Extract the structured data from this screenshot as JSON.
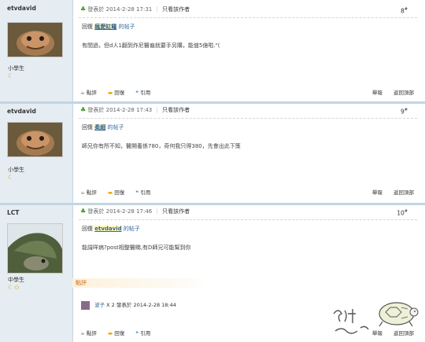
{
  "labels": {
    "posted_prefix": "發表於",
    "only_author": "只看該作者",
    "reply_prefix": "回復",
    "reply_suffix": "的帖子",
    "rate": "點評",
    "reply": "回復",
    "quote": "引用",
    "report": "舉報",
    "back_top": "返回頂部"
  },
  "posts": [
    {
      "username": "etvdavid",
      "rank": "小學生",
      "medals": "☾",
      "datetime": "2014-2-28 17:31",
      "floor": "8",
      "reply_to": "瘋愛缸黿",
      "content": "有間過，但d人1翻到炸尼醫龜就要手另購，能值5億啦.\"("
    },
    {
      "username": "etvdavid",
      "rank": "小學生",
      "medals": "☾",
      "datetime": "2014-2-28 17:43",
      "floor": "9",
      "reply_to": "柔細",
      "content": "師兄你有所不知，醫開養係780，奇何我只得380，先會出此下策"
    },
    {
      "username": "LCT",
      "rank": "中學生",
      "medals": "☾✩",
      "datetime": "2014-2-28 17:46",
      "floor": "10",
      "reply_to": "etvdavid",
      "content": "能識咩病?post相整醫睇,有D師兄可能幫到你",
      "rating_header": "點評",
      "rater": {
        "name": "波子",
        "score": "X 2",
        "datetime": "2014-2-28 18:44"
      }
    }
  ],
  "colors": {
    "sidebar": "#e5edf2",
    "divider": "#c2d5e3",
    "link": "#336699",
    "highlight": "#fff6b4",
    "online": "#3a9a1e"
  }
}
